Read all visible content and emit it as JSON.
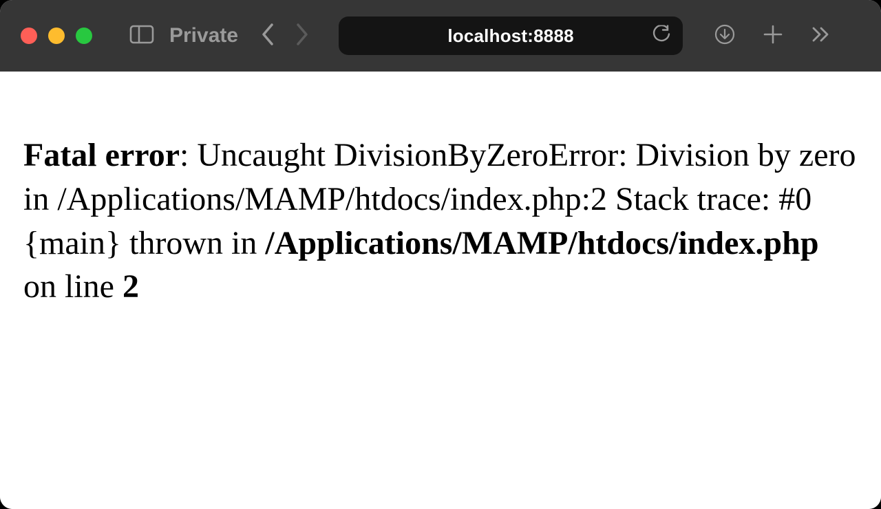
{
  "toolbar": {
    "private_label": "Private",
    "address": "localhost:8888"
  },
  "error": {
    "heading": "Fatal error",
    "colon": ": ",
    "message": "Uncaught DivisionByZeroError: Division by zero in /Applications/MAMP/htdocs/index.php:2 Stack trace: #0 {main} thrown in ",
    "file_path": "/Applications/MAMP/htdocs/index.php",
    "on_line_text": " on line ",
    "line_number": "2"
  }
}
